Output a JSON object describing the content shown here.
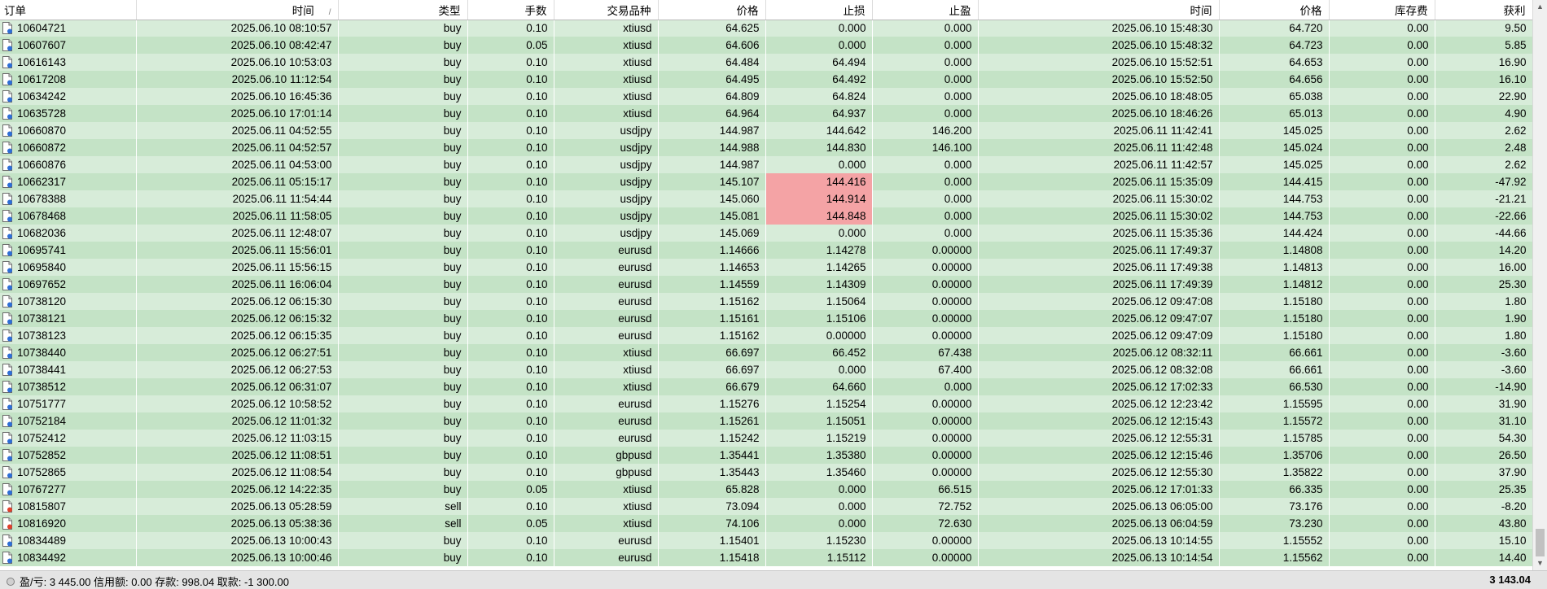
{
  "columns": [
    "订单",
    "时间",
    "类型",
    "手数",
    "交易品种",
    "价格",
    "止损",
    "止盈",
    "时间",
    "价格",
    "库存费",
    "获利"
  ],
  "sort_indicator": "/",
  "rows": [
    {
      "order": "10604721",
      "open_time": "2025.06.10 08:10:57",
      "type": "buy",
      "lots": "0.10",
      "symbol": "xtiusd",
      "price": "64.625",
      "sl": "0.000",
      "tp": "0.000",
      "close_time": "2025.06.10 15:48:30",
      "close_price": "64.720",
      "swap": "0.00",
      "profit": "9.50",
      "sl_hit": false
    },
    {
      "order": "10607607",
      "open_time": "2025.06.10 08:42:47",
      "type": "buy",
      "lots": "0.05",
      "symbol": "xtiusd",
      "price": "64.606",
      "sl": "0.000",
      "tp": "0.000",
      "close_time": "2025.06.10 15:48:32",
      "close_price": "64.723",
      "swap": "0.00",
      "profit": "5.85",
      "sl_hit": false
    },
    {
      "order": "10616143",
      "open_time": "2025.06.10 10:53:03",
      "type": "buy",
      "lots": "0.10",
      "symbol": "xtiusd",
      "price": "64.484",
      "sl": "64.494",
      "tp": "0.000",
      "close_time": "2025.06.10 15:52:51",
      "close_price": "64.653",
      "swap": "0.00",
      "profit": "16.90",
      "sl_hit": false
    },
    {
      "order": "10617208",
      "open_time": "2025.06.10 11:12:54",
      "type": "buy",
      "lots": "0.10",
      "symbol": "xtiusd",
      "price": "64.495",
      "sl": "64.492",
      "tp": "0.000",
      "close_time": "2025.06.10 15:52:50",
      "close_price": "64.656",
      "swap": "0.00",
      "profit": "16.10",
      "sl_hit": false
    },
    {
      "order": "10634242",
      "open_time": "2025.06.10 16:45:36",
      "type": "buy",
      "lots": "0.10",
      "symbol": "xtiusd",
      "price": "64.809",
      "sl": "64.824",
      "tp": "0.000",
      "close_time": "2025.06.10 18:48:05",
      "close_price": "65.038",
      "swap": "0.00",
      "profit": "22.90",
      "sl_hit": false
    },
    {
      "order": "10635728",
      "open_time": "2025.06.10 17:01:14",
      "type": "buy",
      "lots": "0.10",
      "symbol": "xtiusd",
      "price": "64.964",
      "sl": "64.937",
      "tp": "0.000",
      "close_time": "2025.06.10 18:46:26",
      "close_price": "65.013",
      "swap": "0.00",
      "profit": "4.90",
      "sl_hit": false
    },
    {
      "order": "10660870",
      "open_time": "2025.06.11 04:52:55",
      "type": "buy",
      "lots": "0.10",
      "symbol": "usdjpy",
      "price": "144.987",
      "sl": "144.642",
      "tp": "146.200",
      "close_time": "2025.06.11 11:42:41",
      "close_price": "145.025",
      "swap": "0.00",
      "profit": "2.62",
      "sl_hit": false
    },
    {
      "order": "10660872",
      "open_time": "2025.06.11 04:52:57",
      "type": "buy",
      "lots": "0.10",
      "symbol": "usdjpy",
      "price": "144.988",
      "sl": "144.830",
      "tp": "146.100",
      "close_time": "2025.06.11 11:42:48",
      "close_price": "145.024",
      "swap": "0.00",
      "profit": "2.48",
      "sl_hit": false
    },
    {
      "order": "10660876",
      "open_time": "2025.06.11 04:53:00",
      "type": "buy",
      "lots": "0.10",
      "symbol": "usdjpy",
      "price": "144.987",
      "sl": "0.000",
      "tp": "0.000",
      "close_time": "2025.06.11 11:42:57",
      "close_price": "145.025",
      "swap": "0.00",
      "profit": "2.62",
      "sl_hit": false
    },
    {
      "order": "10662317",
      "open_time": "2025.06.11 05:15:17",
      "type": "buy",
      "lots": "0.10",
      "symbol": "usdjpy",
      "price": "145.107",
      "sl": "144.416",
      "tp": "0.000",
      "close_time": "2025.06.11 15:35:09",
      "close_price": "144.415",
      "swap": "0.00",
      "profit": "-47.92",
      "sl_hit": true
    },
    {
      "order": "10678388",
      "open_time": "2025.06.11 11:54:44",
      "type": "buy",
      "lots": "0.10",
      "symbol": "usdjpy",
      "price": "145.060",
      "sl": "144.914",
      "tp": "0.000",
      "close_time": "2025.06.11 15:30:02",
      "close_price": "144.753",
      "swap": "0.00",
      "profit": "-21.21",
      "sl_hit": true
    },
    {
      "order": "10678468",
      "open_time": "2025.06.11 11:58:05",
      "type": "buy",
      "lots": "0.10",
      "symbol": "usdjpy",
      "price": "145.081",
      "sl": "144.848",
      "tp": "0.000",
      "close_time": "2025.06.11 15:30:02",
      "close_price": "144.753",
      "swap": "0.00",
      "profit": "-22.66",
      "sl_hit": true
    },
    {
      "order": "10682036",
      "open_time": "2025.06.11 12:48:07",
      "type": "buy",
      "lots": "0.10",
      "symbol": "usdjpy",
      "price": "145.069",
      "sl": "0.000",
      "tp": "0.000",
      "close_time": "2025.06.11 15:35:36",
      "close_price": "144.424",
      "swap": "0.00",
      "profit": "-44.66",
      "sl_hit": false
    },
    {
      "order": "10695741",
      "open_time": "2025.06.11 15:56:01",
      "type": "buy",
      "lots": "0.10",
      "symbol": "eurusd",
      "price": "1.14666",
      "sl": "1.14278",
      "tp": "0.00000",
      "close_time": "2025.06.11 17:49:37",
      "close_price": "1.14808",
      "swap": "0.00",
      "profit": "14.20",
      "sl_hit": false
    },
    {
      "order": "10695840",
      "open_time": "2025.06.11 15:56:15",
      "type": "buy",
      "lots": "0.10",
      "symbol": "eurusd",
      "price": "1.14653",
      "sl": "1.14265",
      "tp": "0.00000",
      "close_time": "2025.06.11 17:49:38",
      "close_price": "1.14813",
      "swap": "0.00",
      "profit": "16.00",
      "sl_hit": false
    },
    {
      "order": "10697652",
      "open_time": "2025.06.11 16:06:04",
      "type": "buy",
      "lots": "0.10",
      "symbol": "eurusd",
      "price": "1.14559",
      "sl": "1.14309",
      "tp": "0.00000",
      "close_time": "2025.06.11 17:49:39",
      "close_price": "1.14812",
      "swap": "0.00",
      "profit": "25.30",
      "sl_hit": false
    },
    {
      "order": "10738120",
      "open_time": "2025.06.12 06:15:30",
      "type": "buy",
      "lots": "0.10",
      "symbol": "eurusd",
      "price": "1.15162",
      "sl": "1.15064",
      "tp": "0.00000",
      "close_time": "2025.06.12 09:47:08",
      "close_price": "1.15180",
      "swap": "0.00",
      "profit": "1.80",
      "sl_hit": false
    },
    {
      "order": "10738121",
      "open_time": "2025.06.12 06:15:32",
      "type": "buy",
      "lots": "0.10",
      "symbol": "eurusd",
      "price": "1.15161",
      "sl": "1.15106",
      "tp": "0.00000",
      "close_time": "2025.06.12 09:47:07",
      "close_price": "1.15180",
      "swap": "0.00",
      "profit": "1.90",
      "sl_hit": false
    },
    {
      "order": "10738123",
      "open_time": "2025.06.12 06:15:35",
      "type": "buy",
      "lots": "0.10",
      "symbol": "eurusd",
      "price": "1.15162",
      "sl": "0.00000",
      "tp": "0.00000",
      "close_time": "2025.06.12 09:47:09",
      "close_price": "1.15180",
      "swap": "0.00",
      "profit": "1.80",
      "sl_hit": false
    },
    {
      "order": "10738440",
      "open_time": "2025.06.12 06:27:51",
      "type": "buy",
      "lots": "0.10",
      "symbol": "xtiusd",
      "price": "66.697",
      "sl": "66.452",
      "tp": "67.438",
      "close_time": "2025.06.12 08:32:11",
      "close_price": "66.661",
      "swap": "0.00",
      "profit": "-3.60",
      "sl_hit": false
    },
    {
      "order": "10738441",
      "open_time": "2025.06.12 06:27:53",
      "type": "buy",
      "lots": "0.10",
      "symbol": "xtiusd",
      "price": "66.697",
      "sl": "0.000",
      "tp": "67.400",
      "close_time": "2025.06.12 08:32:08",
      "close_price": "66.661",
      "swap": "0.00",
      "profit": "-3.60",
      "sl_hit": false
    },
    {
      "order": "10738512",
      "open_time": "2025.06.12 06:31:07",
      "type": "buy",
      "lots": "0.10",
      "symbol": "xtiusd",
      "price": "66.679",
      "sl": "64.660",
      "tp": "0.000",
      "close_time": "2025.06.12 17:02:33",
      "close_price": "66.530",
      "swap": "0.00",
      "profit": "-14.90",
      "sl_hit": false
    },
    {
      "order": "10751777",
      "open_time": "2025.06.12 10:58:52",
      "type": "buy",
      "lots": "0.10",
      "symbol": "eurusd",
      "price": "1.15276",
      "sl": "1.15254",
      "tp": "0.00000",
      "close_time": "2025.06.12 12:23:42",
      "close_price": "1.15595",
      "swap": "0.00",
      "profit": "31.90",
      "sl_hit": false
    },
    {
      "order": "10752184",
      "open_time": "2025.06.12 11:01:32",
      "type": "buy",
      "lots": "0.10",
      "symbol": "eurusd",
      "price": "1.15261",
      "sl": "1.15051",
      "tp": "0.00000",
      "close_time": "2025.06.12 12:15:43",
      "close_price": "1.15572",
      "swap": "0.00",
      "profit": "31.10",
      "sl_hit": false
    },
    {
      "order": "10752412",
      "open_time": "2025.06.12 11:03:15",
      "type": "buy",
      "lots": "0.10",
      "symbol": "eurusd",
      "price": "1.15242",
      "sl": "1.15219",
      "tp": "0.00000",
      "close_time": "2025.06.12 12:55:31",
      "close_price": "1.15785",
      "swap": "0.00",
      "profit": "54.30",
      "sl_hit": false
    },
    {
      "order": "10752852",
      "open_time": "2025.06.12 11:08:51",
      "type": "buy",
      "lots": "0.10",
      "symbol": "gbpusd",
      "price": "1.35441",
      "sl": "1.35380",
      "tp": "0.00000",
      "close_time": "2025.06.12 12:15:46",
      "close_price": "1.35706",
      "swap": "0.00",
      "profit": "26.50",
      "sl_hit": false
    },
    {
      "order": "10752865",
      "open_time": "2025.06.12 11:08:54",
      "type": "buy",
      "lots": "0.10",
      "symbol": "gbpusd",
      "price": "1.35443",
      "sl": "1.35460",
      "tp": "0.00000",
      "close_time": "2025.06.12 12:55:30",
      "close_price": "1.35822",
      "swap": "0.00",
      "profit": "37.90",
      "sl_hit": false
    },
    {
      "order": "10767277",
      "open_time": "2025.06.12 14:22:35",
      "type": "buy",
      "lots": "0.05",
      "symbol": "xtiusd",
      "price": "65.828",
      "sl": "0.000",
      "tp": "66.515",
      "close_time": "2025.06.12 17:01:33",
      "close_price": "66.335",
      "swap": "0.00",
      "profit": "25.35",
      "sl_hit": false
    },
    {
      "order": "10815807",
      "open_time": "2025.06.13 05:28:59",
      "type": "sell",
      "lots": "0.10",
      "symbol": "xtiusd",
      "price": "73.094",
      "sl": "0.000",
      "tp": "72.752",
      "close_time": "2025.06.13 06:05:00",
      "close_price": "73.176",
      "swap": "0.00",
      "profit": "-8.20",
      "sl_hit": false
    },
    {
      "order": "10816920",
      "open_time": "2025.06.13 05:38:36",
      "type": "sell",
      "lots": "0.05",
      "symbol": "xtiusd",
      "price": "74.106",
      "sl": "0.000",
      "tp": "72.630",
      "close_time": "2025.06.13 06:04:59",
      "close_price": "73.230",
      "swap": "0.00",
      "profit": "43.80",
      "sl_hit": false
    },
    {
      "order": "10834489",
      "open_time": "2025.06.13 10:00:43",
      "type": "buy",
      "lots": "0.10",
      "symbol": "eurusd",
      "price": "1.15401",
      "sl": "1.15230",
      "tp": "0.00000",
      "close_time": "2025.06.13 10:14:55",
      "close_price": "1.15552",
      "swap": "0.00",
      "profit": "15.10",
      "sl_hit": false
    },
    {
      "order": "10834492",
      "open_time": "2025.06.13 10:00:46",
      "type": "buy",
      "lots": "0.10",
      "symbol": "eurusd",
      "price": "1.15418",
      "sl": "1.15112",
      "tp": "0.00000",
      "close_time": "2025.06.13 10:14:54",
      "close_price": "1.15562",
      "swap": "0.00",
      "profit": "14.40",
      "sl_hit": false
    }
  ],
  "footer": {
    "summary": "盈/亏: 3 445.00  信用额: 0.00  存款: 998.04  取款: -1 300.00",
    "total": "3 143.04"
  },
  "colors": {
    "row_light": "#d7ecd9",
    "row_dark": "#c4e3c6",
    "stop_loss_highlight": "#f4a3a5",
    "buy_icon_dot": "#2f6fd6",
    "sell_icon_dot": "#e0402c"
  },
  "icons": {
    "buy": "order-doc-buy-icon",
    "sell": "order-doc-sell-icon"
  }
}
